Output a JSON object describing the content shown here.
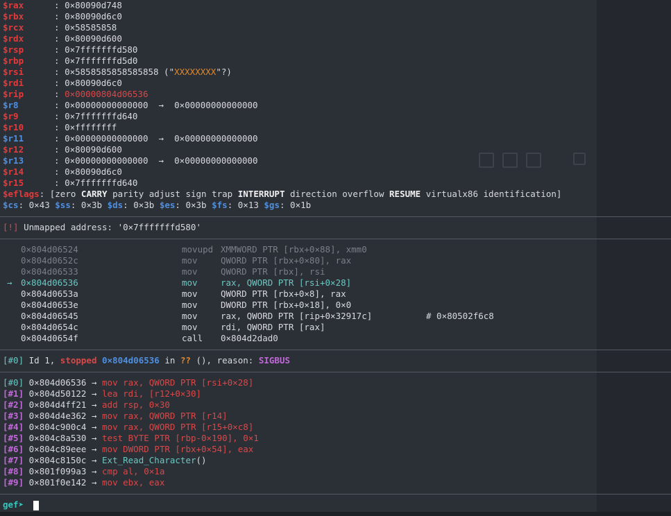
{
  "registers": [
    {
      "name": "$rax",
      "value": "0×80090d748",
      "color": "red"
    },
    {
      "name": "$rbx",
      "value": "0×80090d6c0",
      "color": "red"
    },
    {
      "name": "$rcx",
      "value": "0×58585858",
      "color": "red"
    },
    {
      "name": "$rdx",
      "value": "0×80090d600",
      "color": "red"
    },
    {
      "name": "$rsp",
      "value": "0×7fffffffd580",
      "color": "red"
    },
    {
      "name": "$rbp",
      "value": "0×7fffffffd5d0",
      "color": "red"
    },
    {
      "name": "$rsi",
      "value": "0×5858585858585858",
      "extra_pre": " (\"",
      "extra_str": "XXXXXXXX",
      "extra_post": "\"?)",
      "color": "red"
    },
    {
      "name": "$rdi",
      "value": "0×80090d6c0",
      "color": "red"
    },
    {
      "name": "$rip",
      "value": "0×00000804d06536",
      "color": "red",
      "value_red": true
    },
    {
      "name": "$r8",
      "value": "0×00000000000000",
      "arrow": "→",
      "target": "0×00000000000000",
      "color": "blue"
    },
    {
      "name": "$r9",
      "value": "0×7fffffffd640",
      "color": "red"
    },
    {
      "name": "$r10",
      "value": "0×ffffffff",
      "color": "red"
    },
    {
      "name": "$r11",
      "value": "0×00000000000000",
      "arrow": "→",
      "target": "0×00000000000000",
      "color": "blue"
    },
    {
      "name": "$r12",
      "value": "0×80090d600",
      "color": "red"
    },
    {
      "name": "$r13",
      "value": "0×00000000000000",
      "arrow": "→",
      "target": "0×00000000000000",
      "color": "blue"
    },
    {
      "name": "$r14",
      "value": "0×80090d6c0",
      "color": "red"
    },
    {
      "name": "$r15",
      "value": "0×7fffffffd640",
      "color": "red"
    }
  ],
  "eflags": {
    "name": "$eflags",
    "open": "[",
    "flags": [
      {
        "t": "zero",
        "b": false
      },
      {
        "t": "CARRY",
        "b": true
      },
      {
        "t": "parity",
        "b": false
      },
      {
        "t": "adjust",
        "b": false
      },
      {
        "t": "sign",
        "b": false
      },
      {
        "t": "trap",
        "b": false
      },
      {
        "t": "INTERRUPT",
        "b": true
      },
      {
        "t": "direction",
        "b": false
      },
      {
        "t": "overflow",
        "b": false
      },
      {
        "t": "RESUME",
        "b": true
      },
      {
        "t": "virtualx86",
        "b": false
      },
      {
        "t": "identification",
        "b": false
      }
    ],
    "close": "]"
  },
  "segments": [
    {
      "name": "$cs",
      "value": "0×43"
    },
    {
      "name": "$ss",
      "value": "0×3b"
    },
    {
      "name": "$ds",
      "value": "0×3b"
    },
    {
      "name": "$es",
      "value": "0×3b"
    },
    {
      "name": "$fs",
      "value": "0×13"
    },
    {
      "name": "$gs",
      "value": "0×1b"
    }
  ],
  "unmapped": {
    "tag": "[!]",
    "text": " Unmapped address: '0×7fffffffd580'"
  },
  "disasm": [
    {
      "addr": "0×804d06524",
      "mn": "movupd",
      "op": "XMMWORD PTR [rbx+0×88], xmm0",
      "state": "past"
    },
    {
      "addr": "0×804d0652c",
      "mn": "mov",
      "op": "QWORD PTR [rbx+0×80], rax",
      "state": "past"
    },
    {
      "addr": "0×804d06533",
      "mn": "mov",
      "op": "QWORD PTR [rbx], rsi",
      "state": "past"
    },
    {
      "addr": "0×804d06536",
      "mn": "mov",
      "op": "rax, QWORD PTR [rsi+0×28]",
      "state": "current",
      "marker": "→"
    },
    {
      "addr": "0×804d0653a",
      "mn": "mov",
      "op": "QWORD PTR [rbx+0×8], rax",
      "state": "next"
    },
    {
      "addr": "0×804d0653e",
      "mn": "mov",
      "op": "DWORD PTR [rbx+0×18], 0×0",
      "state": "next"
    },
    {
      "addr": "0×804d06545",
      "mn": "mov",
      "op": "rax, QWORD PTR [rip+0×32917c]",
      "comment": "# 0×80502f6c8",
      "state": "next"
    },
    {
      "addr": "0×804d0654c",
      "mn": "mov",
      "op": "rdi, QWORD PTR [rax]",
      "state": "next"
    },
    {
      "addr": "0×804d0654f",
      "mn": "call",
      "op": "0×804d2dad0",
      "state": "next"
    }
  ],
  "thread": {
    "tag": "[#0]",
    "id": " Id 1, ",
    "status": "stopped",
    "addr": " 0×804d06536",
    "in": " in ",
    "func": "??",
    "args": " (), reason: ",
    "reason": "SIGBUS"
  },
  "trace": [
    {
      "idx": "[#0]",
      "addr": "0×804d06536",
      "arrow": "→",
      "insn": "mov rax, QWORD PTR [rsi+0×28]",
      "kind": "insn"
    },
    {
      "idx": "[#1]",
      "addr": "0×804d50122",
      "arrow": "→",
      "insn": "lea rdi, [r12+0×30]",
      "kind": "insn"
    },
    {
      "idx": "[#2]",
      "addr": "0×804d4ff21",
      "arrow": "→",
      "insn": "add rsp, 0×30",
      "kind": "insn"
    },
    {
      "idx": "[#3]",
      "addr": "0×804d4e362",
      "arrow": "→",
      "insn": "mov rax, QWORD PTR [r14]",
      "kind": "insn"
    },
    {
      "idx": "[#4]",
      "addr": "0×804c900c4",
      "arrow": "→",
      "insn": "mov rax, QWORD PTR [r15+0×c8]",
      "kind": "insn"
    },
    {
      "idx": "[#5]",
      "addr": "0×804c8a530",
      "arrow": "→",
      "insn": "test BYTE PTR [rbp-0×190], 0×1",
      "kind": "insn"
    },
    {
      "idx": "[#6]",
      "addr": "0×804c89eee",
      "arrow": "→",
      "insn": "mov DWORD PTR [rbx+0×54], eax",
      "kind": "insn"
    },
    {
      "idx": "[#7]",
      "addr": "0×804c8150c",
      "arrow": "→",
      "insn": "Ext_Read_Character",
      "suffix": "()",
      "kind": "func"
    },
    {
      "idx": "[#8]",
      "addr": "0×801f099a3",
      "arrow": "→",
      "insn": "cmp al, 0×1a",
      "kind": "insn"
    },
    {
      "idx": "[#9]",
      "addr": "0×801f0e142",
      "arrow": "→",
      "insn": "mov ebx, eax",
      "kind": "insn"
    }
  ],
  "prompt": {
    "text": "gef➤ "
  }
}
